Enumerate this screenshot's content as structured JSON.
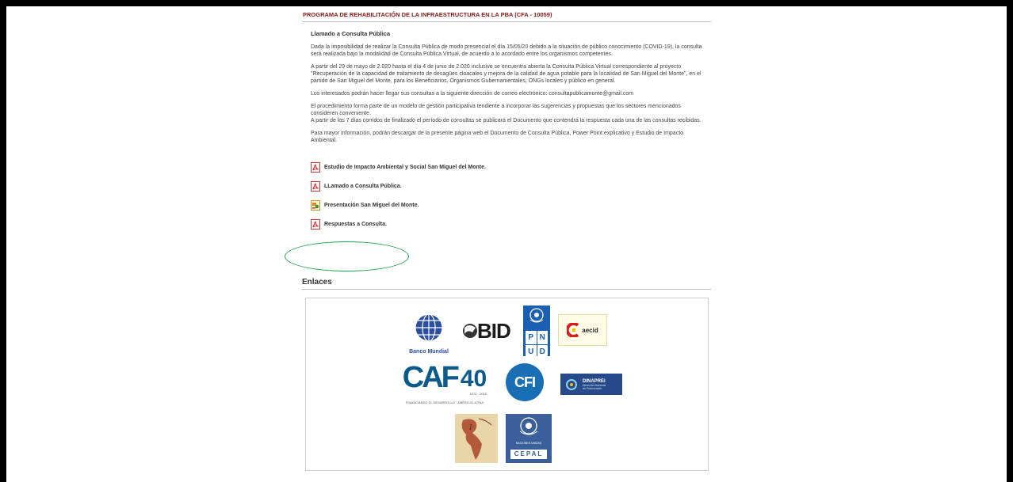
{
  "page": {
    "title": "PROGRAMA DE REHABILITACIÓN DE LA INFRAESTRUCTURA EN LA PBA (CFA - 10059)",
    "section_title": "Llamado a Consulta Pública",
    "paragraphs": [
      "Dada la imposibilidad de realizar la Consulta Pública de modo presencial el día 15/05/20 debido a la situación de público conocimiento (COVID-19), la consulta será realizada bajo la modalidad de Consulta Pública Virtual, de acuerdo a lo acordado entre los organismos competentes.",
      "A partir del 29 de mayo de 2.020 hasta el día 4 de junio de 2.020 inclusive se encuentra abierta la Consulta Pública Virtual correspondiente al proyecto \"Recuperación de la capacidad de tratamiento de desagües cloacales y mejora de la calidad de agua potable para la localidad de San Miguel del Monte\", en el partido de San Miguel del Monte, para los Beneficiarios, Organismos Gubernamentales, ONGs locales y público en general.",
      "Los interesados podrán hacer llegar sus consultas a la siguiente dirección de correo electrónico: consultapublicamonte@gmail.com",
      "El procedimiento forma parte de un modelo de gestión participativa tendiente a incorporar las sugerencias y propuestas que los sectores mencionados consideren conveniente.",
      "A partir de los 7 días corridos de finalizado el período de consultas se publicará el Documento que contendrá la respuesta cada una de las consultas recibidas.",
      "Para mayor información, podrán descargar de la presente página web el Documento de Consulta Pública, Power Point explicativo y Estudio de Impacto Ambiental."
    ],
    "documents": [
      {
        "label": "Estudio de Impacto Ambiental y Social San Miguel del Monte.",
        "icon": "pdf-icon"
      },
      {
        "label": "LLamado a Consulta Pública.",
        "icon": "pdf-icon"
      },
      {
        "label": "Presentación San Miguel del Monte.",
        "icon": "powerpoint-icon"
      },
      {
        "label": "Respuestas a Consulta.",
        "icon": "pdf-icon"
      }
    ],
    "links_heading": "Enlaces",
    "logos": {
      "banco_mundial": "Banco Mundial",
      "bid": "BID",
      "pnud": [
        "P",
        "N",
        "U",
        "D"
      ],
      "aecid": "aecid",
      "caf_main": "CAF",
      "caf_number": "40",
      "caf_years": "1970 - 2010",
      "caf_tagline": "FINANCIANDO EL DESARROLLO  ·  AMÉRICA LATINA",
      "cfi": "CFI",
      "dinaprei": "DINAPREI",
      "dinaprei_sub1": "Dirección Nacional",
      "dinaprei_sub2": "de Preinversión",
      "cepal": "CEPAL",
      "cepal_sub": "NACIONES UNIDAS"
    },
    "colors": {
      "title_red": "#8b1a1a",
      "highlight_green": "#1ea44a",
      "caf_blue": "#0a5a8c",
      "caf_green": "#3aa04a",
      "pnud_blue": "#1a5fb4"
    }
  }
}
